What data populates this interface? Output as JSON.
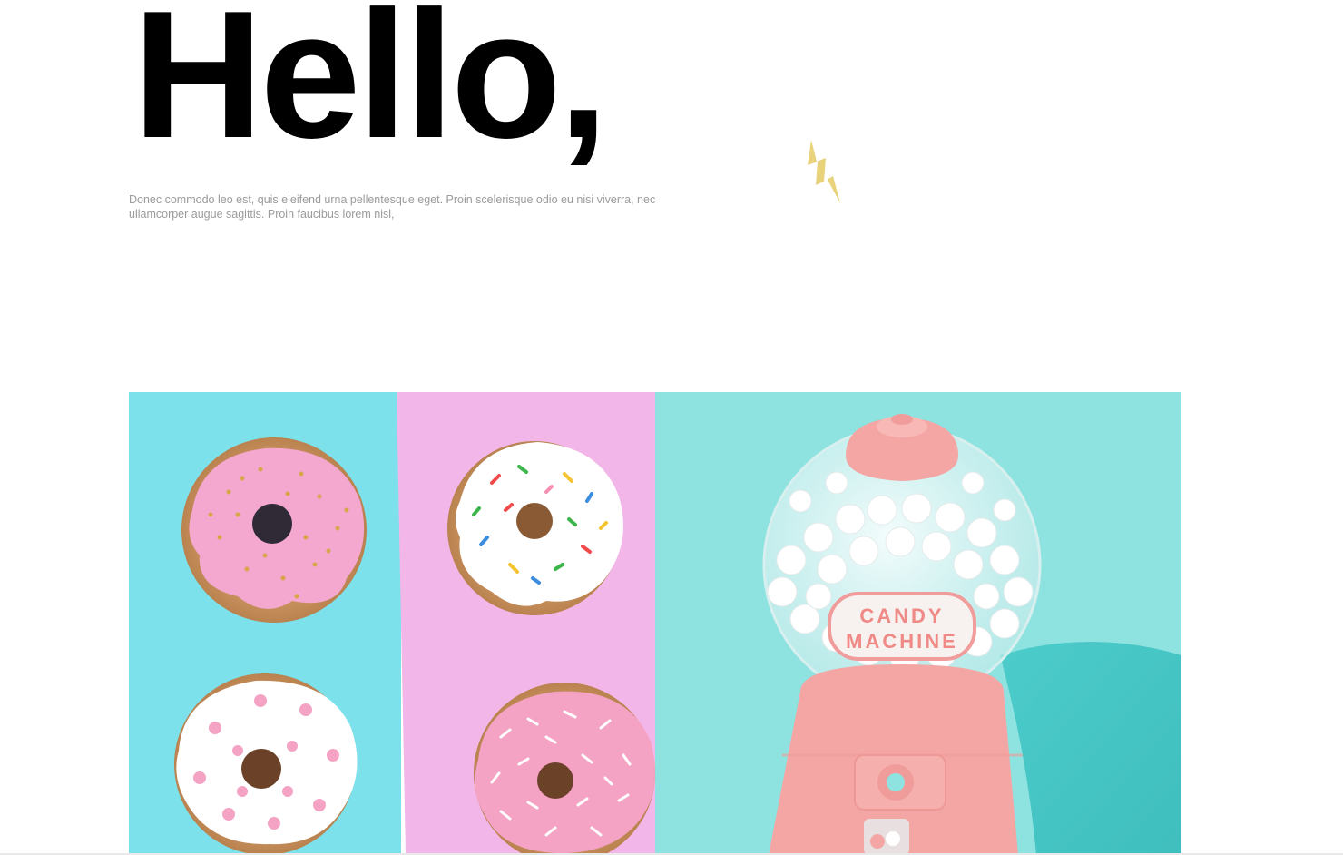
{
  "hero": {
    "heading": "Hello,",
    "text": "Donec commodo leo est, quis eleifend urna pellentesque eget. Proin scelerisque odio eu nisi viverra, nec ullamcorper augue sagittis. Proin faucibus lorem nisl,"
  },
  "decoration": {
    "icon": "lightning-bolt-icon",
    "color": "#e8d27a"
  },
  "gallery": {
    "photos": [
      {
        "subject": "donuts-on-blue-and-pink-background",
        "colors": [
          "#7de1ec",
          "#f3b6e8"
        ]
      },
      {
        "subject": "candy-machine",
        "color": "#8ee3e0"
      }
    ],
    "candy_label": [
      "CANDY",
      "MACHINE"
    ]
  }
}
